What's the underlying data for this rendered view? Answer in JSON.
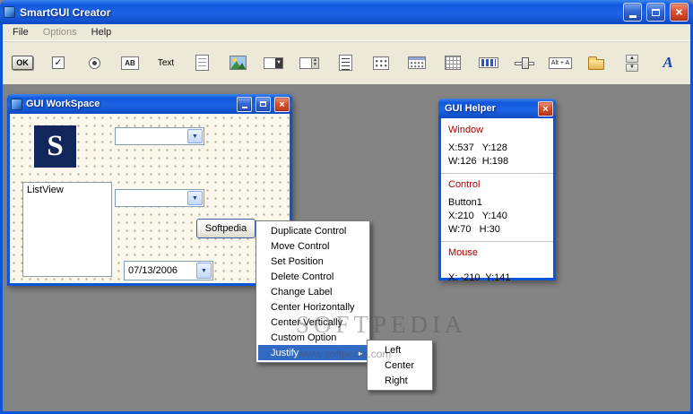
{
  "app": {
    "title": "SmartGUI Creator",
    "menu": {
      "file": "File",
      "options": "Options",
      "help": "Help"
    }
  },
  "toolbar": {
    "ok_label": "OK",
    "ab_label": "AB",
    "text_label": "Text",
    "hotkey_label": "Alt + A",
    "font_glyph": "A"
  },
  "workspace": {
    "title": "GUI WorkSpace",
    "logo_letter": "S",
    "listview_label": "ListView",
    "button_label": "Softpedia",
    "date_value": "07/13/2006"
  },
  "helper": {
    "title": "GUI Helper",
    "sections": {
      "window_header": "Window",
      "window_pos": "X:537   Y:128",
      "window_size": "W:126  H:198",
      "control_header": "Control",
      "control_name": "Button1",
      "control_pos": "X:210   Y:140",
      "control_size": "W:70   H:30",
      "mouse_header": "Mouse",
      "mouse_pos": "X: -210  Y:141"
    }
  },
  "context_menu": {
    "items": [
      "Duplicate Control",
      "Move Control",
      "Set Position",
      "Delete Control",
      "Change Label",
      "Center Horizontally",
      "Center Vertically",
      "Custom Option",
      "Justify"
    ],
    "submenu": [
      "Left",
      "Center",
      "Right"
    ]
  },
  "watermark": {
    "title": "SOFTPEDIA",
    "url": "www.softpedia.com"
  }
}
